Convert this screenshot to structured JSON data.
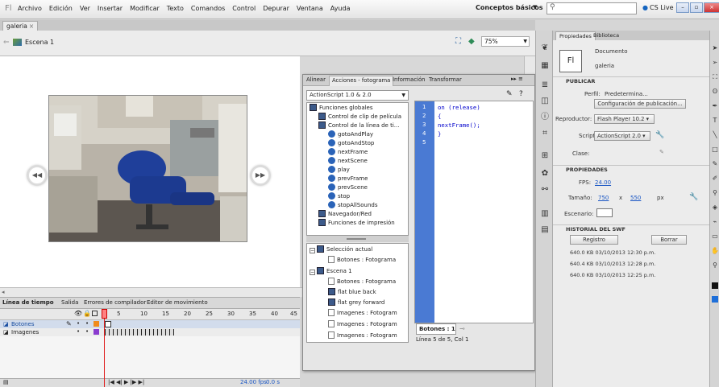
{
  "app": {
    "logo": "Fl",
    "menus": [
      "Archivo",
      "Edición",
      "Ver",
      "Insertar",
      "Modificar",
      "Texto",
      "Comandos",
      "Control",
      "Depurar",
      "Ventana",
      "Ayuda"
    ],
    "workspace": "Conceptos básicos",
    "search_placeholder": "",
    "cslive": "CS Live"
  },
  "document": {
    "tab": "galeria",
    "tab_close": "×",
    "scene": "Escena 1",
    "zoom": "75%"
  },
  "timeline": {
    "tabs": [
      "Línea de tiempo",
      "Salida",
      "Errores de compilador",
      "Editor de movimiento"
    ],
    "frame_numbers": [
      "5",
      "10",
      "15",
      "20",
      "25",
      "30",
      "35",
      "40",
      "45"
    ],
    "layers": [
      {
        "name": "Botones"
      },
      {
        "name": "Imagenes"
      }
    ],
    "fps": "24.00 fps",
    "time": "0.0 s"
  },
  "actions_panel": {
    "tabs": [
      "Alinear",
      "Acciones - fotograma",
      "Información",
      "Transformar"
    ],
    "version": "ActionScript 1.0 & 2.0",
    "tree": [
      "Funciones globales",
      "Control de clip de película",
      "Control de la línea de ti...",
      "gotoAndPlay",
      "gotoAndStop",
      "nextFrame",
      "nextScene",
      "play",
      "prevFrame",
      "prevScene",
      "stop",
      "stopAllSounds",
      "Navegador/Red",
      "Funciones de impresión"
    ],
    "tree2": [
      "Selección actual",
      "Botones : Fotograma",
      "Escena 1",
      "Botones : Fotograma",
      "flat blue back",
      "flat grey forward",
      "Imagenes : Fotogram",
      "Imagenes : Fotogram",
      "Imagenes : Fotogram"
    ],
    "line_numbers": [
      "1",
      "2",
      "3",
      "4",
      "5"
    ],
    "code": [
      "on (release)",
      "{",
      "nextFrame();",
      "}",
      ""
    ],
    "script_tab": "Botones : 1",
    "status": "Línea 5 de 5, Col 1"
  },
  "properties": {
    "tabs": [
      "Propiedades",
      "Biblioteca"
    ],
    "doc_type": "Documento",
    "doc_name": "galeria",
    "fl_label": "Fl",
    "publish_section": "PUBLICAR",
    "profile_label": "Perfil:",
    "profile_value": "Predetermina...",
    "publish_settings_button": "Configuración de publicación...",
    "player_label": "Reproductor:",
    "player_value": "Flash Player 10.2",
    "script_label": "Script:",
    "script_value": "ActionScript 2.0",
    "class_label": "Clase:",
    "properties_section": "PROPIEDADES",
    "fps_label": "FPS:",
    "fps_value": "24.00",
    "size_label": "Tamaño:",
    "width": "750",
    "x": "x",
    "height": "550",
    "unit": "px",
    "stage_label": "Escenario:",
    "swf_section": "HISTORIAL DEL SWF",
    "log_button": "Registro",
    "clear_button": "Borrar",
    "history": [
      "640.0 KB  03/10/2013  12:30 p.m.",
      "640.4 KB  03/10/2013  12:28 p.m.",
      "640.0 KB  03/10/2013  12:25 p.m."
    ]
  }
}
